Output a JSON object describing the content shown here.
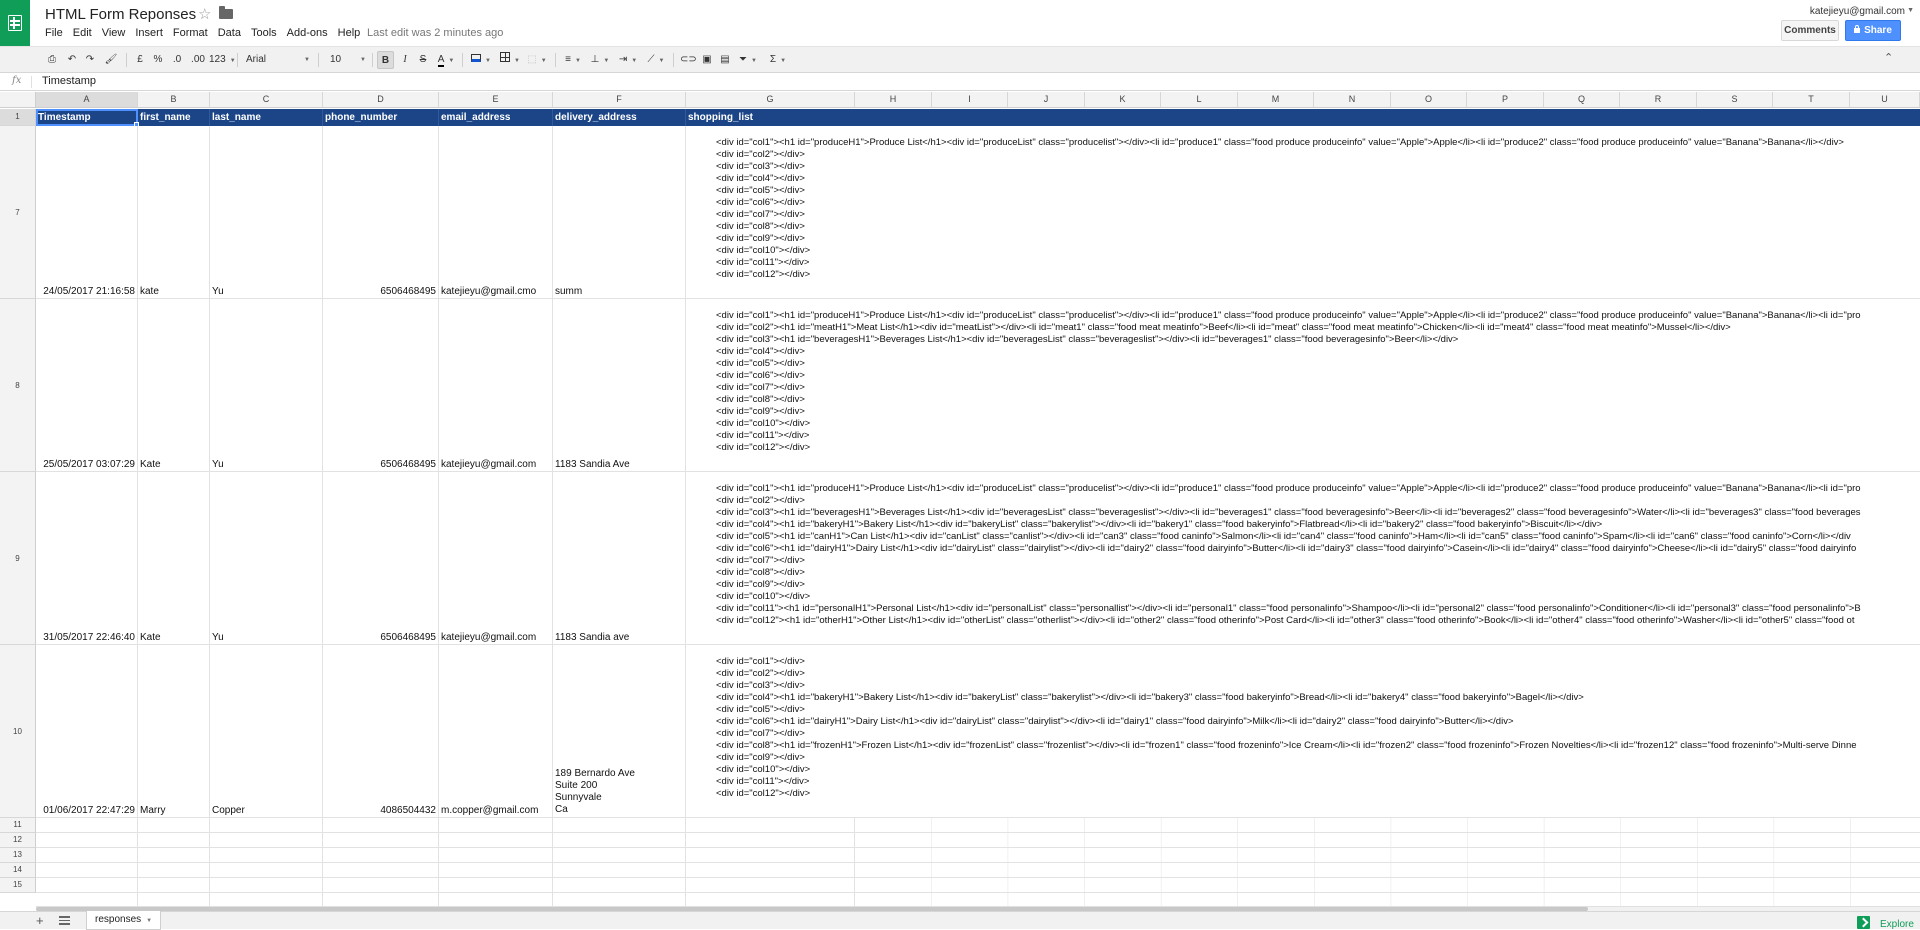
{
  "app": {
    "title": "HTML Form Reponses",
    "last_edit": "Last edit was 2 minutes ago",
    "user_email": "katejieyu@gmail.com",
    "comments_label": "Comments",
    "share_label": "Share"
  },
  "menu": [
    "File",
    "Edit",
    "View",
    "Insert",
    "Format",
    "Data",
    "Tools",
    "Add-ons",
    "Help"
  ],
  "toolbar": {
    "currency": "£",
    "percent": "%",
    "dec_decrease": ".0",
    "dec_increase": ".00",
    "more_formats": "123",
    "font_family": "Arial",
    "font_size": "10",
    "bold": "B",
    "italic": "I",
    "strike": "S",
    "text_color": "A",
    "sum": "Σ"
  },
  "formula_bar": {
    "fx": "fx",
    "value": "Timestamp"
  },
  "columns": [
    "A",
    "B",
    "C",
    "D",
    "E",
    "F",
    "G",
    "H",
    "I",
    "J",
    "K",
    "L",
    "M",
    "N",
    "O",
    "P",
    "Q",
    "R",
    "S",
    "T",
    "U"
  ],
  "header_row": {
    "number": "1",
    "cells": [
      "Timestamp",
      "first_name",
      "last_name",
      "phone_number",
      "email_address",
      "delivery_address",
      "shopping_list"
    ]
  },
  "rows": [
    {
      "number": "7",
      "timestamp": "24/05/2017 21:16:58",
      "first_name": "kate",
      "last_name": "Yu",
      "phone_number": "6506468495",
      "email_address": "katejieyu@gmail.cmo",
      "delivery_address": "summ",
      "shopping_list": "<div id=\"col1\"><h1 id=\"produceH1\">Produce List</h1><div id=\"produceList\" class=\"producelist\"></div><li id=\"produce1\" class=\"food produce produceinfo\" value=\"Apple\">Apple</li><li id=\"produce2\" class=\"food produce produceinfo\" value=\"Banana\">Banana</li></div>\n<div id=\"col2\"></div>\n<div id=\"col3\"></div>\n<div id=\"col4\"></div>\n<div id=\"col5\"></div>\n<div id=\"col6\"></div>\n<div id=\"col7\"></div>\n<div id=\"col8\"></div>\n<div id=\"col9\"></div>\n<div id=\"col10\"></div>\n<div id=\"col11\"></div>\n<div id=\"col12\"></div>"
    },
    {
      "number": "8",
      "timestamp": "25/05/2017 03:07:29",
      "first_name": "Kate",
      "last_name": "Yu",
      "phone_number": "6506468495",
      "email_address": "katejieyu@gmail.com",
      "delivery_address": "1183 Sandia Ave",
      "shopping_list": "<div id=\"col1\"><h1 id=\"produceH1\">Produce List</h1><div id=\"produceList\" class=\"producelist\"></div><li id=\"produce1\" class=\"food produce produceinfo\" value=\"Apple\">Apple</li><li id=\"produce2\" class=\"food produce produceinfo\" value=\"Banana\">Banana</li><li id=\"pro\n<div id=\"col2\"><h1 id=\"meatH1\">Meat List</h1><div id=\"meatList\"></div><li id=\"meat1\" class=\"food meat meatinfo\">Beef</li><li id=\"meat\" class=\"food meat meatinfo\">Chicken</li><li id=\"meat4\" class=\"food meat meatinfo\">Mussel</li></div>\n<div id=\"col3\"><h1 id=\"beveragesH1\">Beverages List</h1><div id=\"beveragesList\" class=\"beverageslist\"></div><li id=\"beverages1\" class=\"food beveragesinfo\">Beer</li></div>\n<div id=\"col4\"></div>\n<div id=\"col5\"></div>\n<div id=\"col6\"></div>\n<div id=\"col7\"></div>\n<div id=\"col8\"></div>\n<div id=\"col9\"></div>\n<div id=\"col10\"></div>\n<div id=\"col11\"></div>\n<div id=\"col12\"></div>"
    },
    {
      "number": "9",
      "timestamp": "31/05/2017 22:46:40",
      "first_name": "Kate",
      "last_name": "Yu",
      "phone_number": "6506468495",
      "email_address": "katejieyu@gmail.com",
      "delivery_address": "1183 Sandia ave",
      "shopping_list": "<div id=\"col1\"><h1 id=\"produceH1\">Produce List</h1><div id=\"produceList\" class=\"producelist\"></div><li id=\"produce1\" class=\"food produce produceinfo\" value=\"Apple\">Apple</li><li id=\"produce2\" class=\"food produce produceinfo\" value=\"Banana\">Banana</li><li id=\"pro\n<div id=\"col2\"></div>\n<div id=\"col3\"><h1 id=\"beveragesH1\">Beverages List</h1><div id=\"beveragesList\" class=\"beverageslist\"></div><li id=\"beverages1\" class=\"food beveragesinfo\">Beer</li><li id=\"beverages2\" class=\"food beveragesinfo\">Water</li><li id=\"beverages3\" class=\"food beverages\n<div id=\"col4\"><h1 id=\"bakeryH1\">Bakery List</h1><div id=\"bakeryList\" class=\"bakerylist\"></div><li id=\"bakery1\" class=\"food bakeryinfo\">Flatbread</li><li id=\"bakery2\" class=\"food bakeryinfo\">Biscuit</li></div>\n<div id=\"col5\"><h1 id=\"canH1\">Can List</h1><div id=\"canList\" class=\"canlist\"></div><li id=\"can3\" class=\"food caninfo\">Salmon</li><li id=\"can4\" class=\"food caninfo\">Ham</li><li id=\"can5\" class=\"food caninfo\">Spam</li><li id=\"can6\" class=\"food caninfo\">Corn</li></div\n<div id=\"col6\"><h1 id=\"dairyH1\">Dairy List</h1><div id=\"dairyList\" class=\"dairylist\"></div><li id=\"dairy2\" class=\"food dairyinfo\">Butter</li><li id=\"dairy3\" class=\"food dairyinfo\">Casein</li><li id=\"dairy4\" class=\"food dairyinfo\">Cheese</li><li id=\"dairy5\" class=\"food dairyinfo\n<div id=\"col7\"></div>\n<div id=\"col8\"></div>\n<div id=\"col9\"></div>\n<div id=\"col10\"></div>\n<div id=\"col11\"><h1 id=\"personalH1\">Personal List</h1><div id=\"personalList\" class=\"personallist\"></div><li id=\"personal1\" class=\"food personalinfo\">Shampoo</li><li id=\"personal2\" class=\"food personalinfo\">Conditioner</li><li id=\"personal3\" class=\"food personalinfo\">B\n<div id=\"col12\"><h1 id=\"otherH1\">Other List</h1><div id=\"otherList\" class=\"otherlist\"></div><li id=\"other2\" class=\"food otherinfo\">Post Card</li><li id=\"other3\" class=\"food otherinfo\">Book</li><li id=\"other4\" class=\"food otherinfo\">Washer</li><li id=\"other5\" class=\"food ot"
    },
    {
      "number": "10",
      "timestamp": "01/06/2017 22:47:29",
      "first_name": "Marry",
      "last_name": "Copper",
      "phone_number": "4086504432",
      "email_address": "m.copper@gmail.com",
      "delivery_address": "189 Bernardo Ave\nSuite 200\nSunnyvale\nCa",
      "shopping_list": "<div id=\"col1\"></div>\n<div id=\"col2\"></div>\n<div id=\"col3\"></div>\n<div id=\"col4\"><h1 id=\"bakeryH1\">Bakery List</h1><div id=\"bakeryList\" class=\"bakerylist\"></div><li id=\"bakery3\" class=\"food bakeryinfo\">Bread</li><li id=\"bakery4\" class=\"food bakeryinfo\">Bagel</li></div>\n<div id=\"col5\"></div>\n<div id=\"col6\"><h1 id=\"dairyH1\">Dairy List</h1><div id=\"dairyList\" class=\"dairylist\"></div><li id=\"dairy1\" class=\"food dairyinfo\">Milk</li><li id=\"dairy2\" class=\"food dairyinfo\">Butter</li></div>\n<div id=\"col7\"></div>\n<div id=\"col8\"><h1 id=\"frozenH1\">Frozen List</h1><div id=\"frozenList\" class=\"frozenlist\"></div><li id=\"frozen1\" class=\"food frozeninfo\">Ice Cream</li><li id=\"frozen2\" class=\"food frozeninfo\">Frozen Novelties</li><li id=\"frozen12\" class=\"food frozeninfo\">Multi-serve Dinne\n<div id=\"col9\"></div>\n<div id=\"col10\"></div>\n<div id=\"col11\"></div>\n<div id=\"col12\"></div>"
    }
  ],
  "empty_rows": [
    "11",
    "12",
    "13",
    "14",
    "15"
  ],
  "sheets": {
    "active": "responses"
  },
  "explore_label": "Explore",
  "colors": {
    "brand_green": "#0f9d58",
    "header_band": "#1c4587",
    "share_blue": "#4d90fe"
  }
}
